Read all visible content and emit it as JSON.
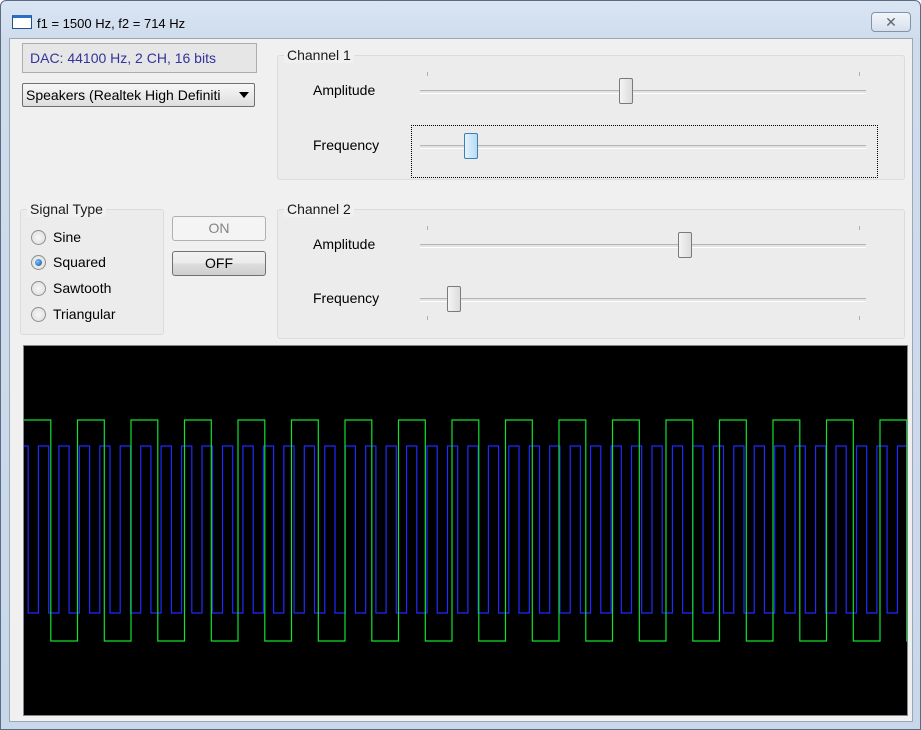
{
  "window": {
    "title": "f1 = 1500 Hz, f2 = 714 Hz",
    "close_glyph": "✕"
  },
  "dac_info": "DAC: 44100 Hz, 2 CH, 16 bits",
  "output_device": "Speakers (Realtek High Definiti",
  "channel1": {
    "label": "Channel 1",
    "amplitude_label": "Amplitude",
    "frequency_label": "Frequency",
    "amplitude_level": 0.46,
    "frequency_level": 0.09
  },
  "channel2": {
    "label": "Channel 2",
    "amplitude_label": "Amplitude",
    "frequency_label": "Frequency",
    "amplitude_level": 0.6,
    "frequency_level": 0.05
  },
  "signal_type": {
    "label": "Signal Type",
    "options": [
      "Sine",
      "Squared",
      "Sawtooth",
      "Triangular"
    ],
    "selected": "Squared"
  },
  "buttons": {
    "on_label": "ON",
    "off_label": "OFF",
    "on_enabled": false
  },
  "scope": {
    "background": "#000000",
    "channel1_color": "#1f2bff",
    "channel2_color": "#12e12e",
    "f1_hz": 1500,
    "f2_hz": 714
  },
  "colors": {
    "dac_text": "#33339a",
    "active_thumb": "#b7dcf5"
  }
}
